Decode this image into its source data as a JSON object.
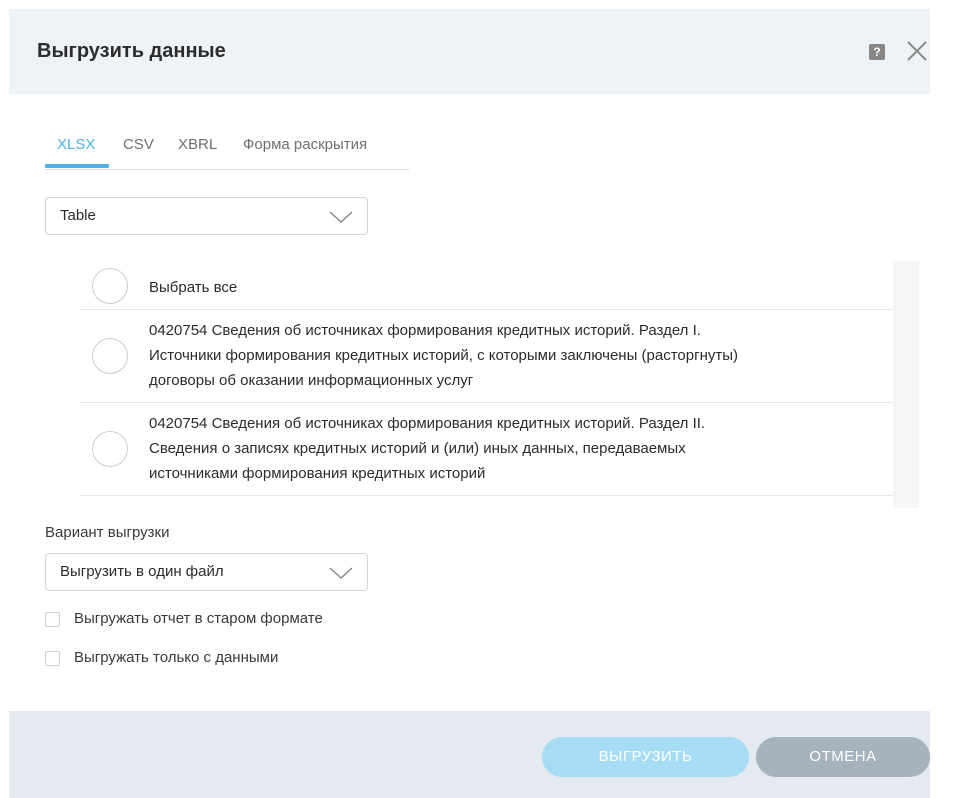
{
  "dialog": {
    "title": "Выгрузить данные",
    "help_icon": "?"
  },
  "tabs": [
    {
      "label": "XLSX",
      "active": true
    },
    {
      "label": "CSV",
      "active": false
    },
    {
      "label": "XBRL",
      "active": false
    },
    {
      "label": "Форма раскрытия",
      "active": false
    }
  ],
  "table_select": {
    "value": "Table"
  },
  "list": {
    "select_all": "Выбрать все",
    "items": [
      {
        "lines": [
          "0420754 Сведения об источниках формирования кредитных историй. Раздел I.",
          "Источники формирования кредитных историй, с которыми заключены (расторгнуты)",
          "договоры об оказании информационных услуг"
        ]
      },
      {
        "lines": [
          "0420754 Сведения об источниках формирования кредитных историй. Раздел II.",
          "Сведения о записях кредитных историй и (или) иных данных, передаваемых",
          "источниками формирования кредитных историй"
        ]
      }
    ]
  },
  "export_variant": {
    "label": "Вариант выгрузки",
    "value": "Выгрузить в один файл"
  },
  "options": {
    "old_format": "Выгружать отчет в старом формате",
    "only_data": "Выгружать только с данными"
  },
  "buttons": {
    "export": "ВЫГРУЗИТЬ",
    "cancel": "ОТМЕНА"
  },
  "colors": {
    "accent": "#4fb3e6",
    "export_button": "#a7dcf5",
    "cancel_button": "#a6b3bd",
    "header_bg": "#eef3f7",
    "footer_bg": "#e4eaef"
  }
}
